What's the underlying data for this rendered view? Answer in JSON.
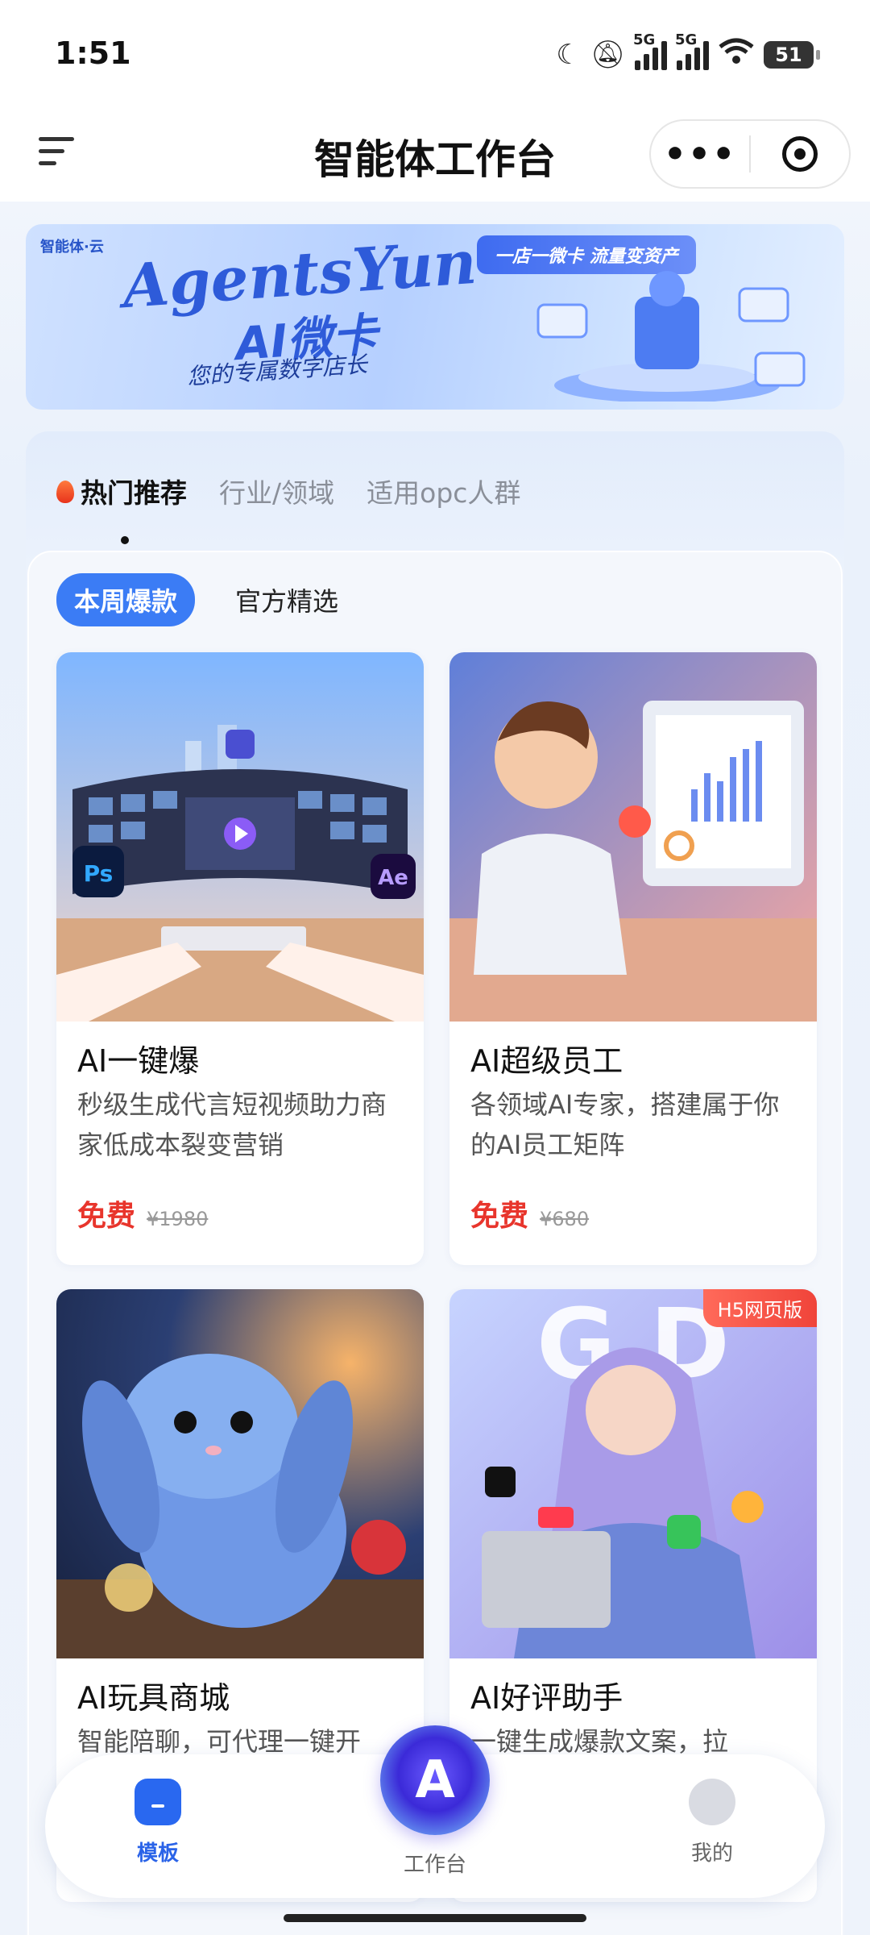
{
  "status_bar": {
    "time": "1:51",
    "battery": "51"
  },
  "nav": {
    "title": "智能体工作台",
    "more_icon": "more-dots-icon",
    "close_icon": "target-icon"
  },
  "banner": {
    "logo_text": "智能体·云",
    "brand": "AgentsYun",
    "product": "AI微卡",
    "tagline": "您的专属数字店长",
    "slogan": "一店一微卡 流量变资产"
  },
  "tabs": [
    {
      "label": "热门推荐",
      "active": true
    },
    {
      "label": "行业/领域",
      "active": false
    },
    {
      "label": "适用opc人群",
      "active": false
    }
  ],
  "subtabs": [
    {
      "label": "本周爆款",
      "active": true
    },
    {
      "label": "官方精选",
      "active": false
    }
  ],
  "cards": [
    {
      "name": "AI一键爆",
      "desc": "秒级生成代言短视频助力商家低成本裂变营销",
      "price": "免费",
      "orig_price": "¥1980"
    },
    {
      "name": "AI超级员工",
      "desc": "各领域AI专家，搭建属于你的AI员工矩阵",
      "price": "免费",
      "orig_price": "¥680"
    },
    {
      "name": "AI玩具商城",
      "desc": "智能陪聊，可代理一键开"
    },
    {
      "name": "AI好评助手",
      "desc": "一键生成爆款文案，拉",
      "badge": "H5网页版"
    }
  ],
  "bottom_nav": [
    {
      "label": "模板",
      "icon": "template-icon",
      "active": true
    },
    {
      "label": "工作台",
      "icon": "workbench-logo-icon",
      "active": false
    },
    {
      "label": "我的",
      "icon": "profile-icon",
      "active": false
    }
  ],
  "colors": {
    "accent": "#3b7cf5",
    "price": "#e8352c",
    "active_nav": "#2a63e8"
  }
}
